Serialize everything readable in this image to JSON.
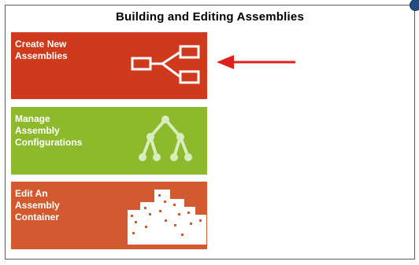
{
  "page": {
    "title": "Building and Editing Assemblies"
  },
  "tiles": [
    {
      "label": "Create New\nAssemblies",
      "color": "#cf3a1c",
      "icon": "hierarchy-tree-icon"
    },
    {
      "label": "Manage\nAssembly\nConfigurations",
      "color": "#8dba2c",
      "icon": "branching-tree-icon"
    },
    {
      "label": "Edit An\nAssembly\nContainer",
      "color": "#d25a2e",
      "icon": "city-buildings-icon"
    }
  ],
  "annotation": {
    "arrow_color": "#e0201b",
    "icon": "red-arrow-pointer-icon"
  },
  "colors": {
    "help_badge": "#1d4f86"
  }
}
